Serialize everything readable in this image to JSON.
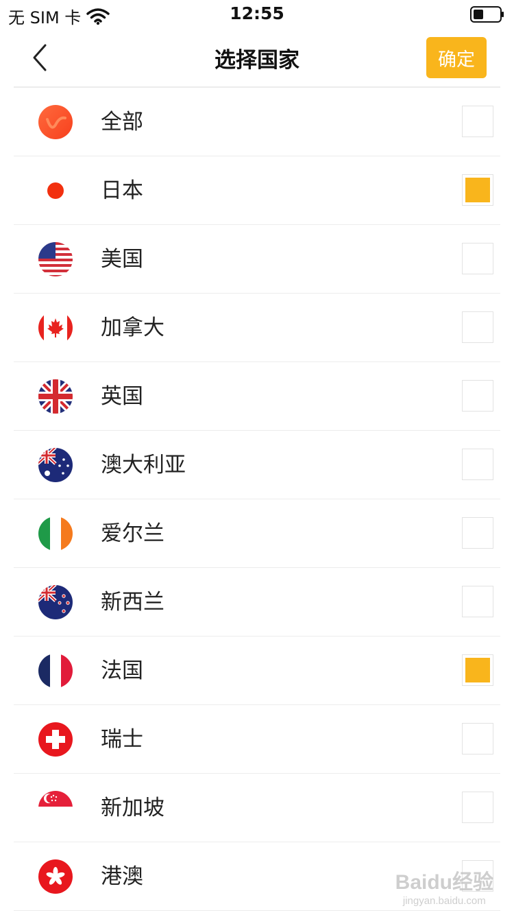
{
  "status_bar": {
    "carrier": "无 SIM 卡",
    "time": "12:55",
    "wifi_icon": "wifi-icon",
    "battery_icon": "battery-icon"
  },
  "nav": {
    "back_icon": "chevron-left-icon",
    "title": "选择国家",
    "confirm_label": "确定"
  },
  "colors": {
    "accent": "#f9b51c",
    "divider": "#ececec"
  },
  "countries": [
    {
      "label": "全部",
      "flag": "all-icon",
      "checked": false
    },
    {
      "label": "日本",
      "flag": "flag-japan-icon",
      "checked": true
    },
    {
      "label": "美国",
      "flag": "flag-usa-icon",
      "checked": false
    },
    {
      "label": "加拿大",
      "flag": "flag-canada-icon",
      "checked": false
    },
    {
      "label": "英国",
      "flag": "flag-uk-icon",
      "checked": false
    },
    {
      "label": "澳大利亚",
      "flag": "flag-australia-icon",
      "checked": false
    },
    {
      "label": "爱尔兰",
      "flag": "flag-ireland-icon",
      "checked": false
    },
    {
      "label": "新西兰",
      "flag": "flag-new-zealand-icon",
      "checked": false
    },
    {
      "label": "法国",
      "flag": "flag-france-icon",
      "checked": true
    },
    {
      "label": "瑞士",
      "flag": "flag-switzerland-icon",
      "checked": false
    },
    {
      "label": "新加坡",
      "flag": "flag-singapore-icon",
      "checked": false
    },
    {
      "label": "港澳",
      "flag": "flag-hongkong-icon",
      "checked": false
    }
  ],
  "watermark": {
    "main": "Baidu经验",
    "sub": "jingyan.baidu.com"
  }
}
